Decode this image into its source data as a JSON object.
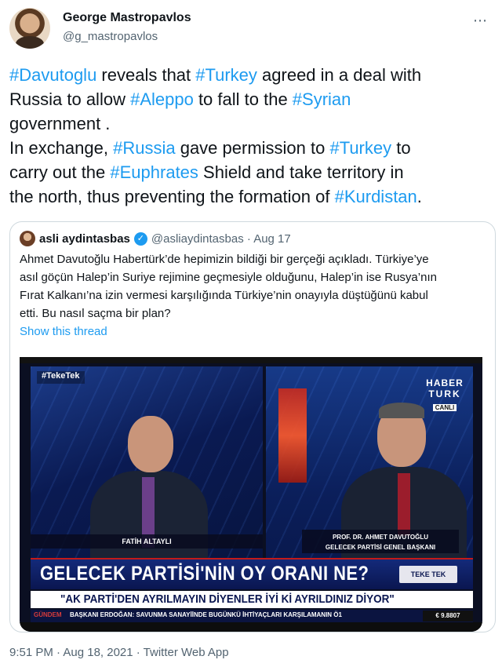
{
  "author": {
    "name": "George Mastropavlos",
    "handle": "@g_mastropavlos",
    "more_icon": "⋯"
  },
  "tweet": {
    "lines": [
      [
        {
          "t": "#Davutoglu",
          "tag": true
        },
        {
          "t": " reveals that "
        },
        {
          "t": "#Turkey",
          "tag": true
        },
        {
          "t": " agreed in a deal with"
        }
      ],
      [
        {
          "t": "Russia to allow "
        },
        {
          "t": "#Aleppo",
          "tag": true
        },
        {
          "t": " to fall to the "
        },
        {
          "t": "#Syrian",
          "tag": true
        }
      ],
      [
        {
          "t": "government ."
        }
      ],
      [
        {
          "t": "In exchange, "
        },
        {
          "t": "#Russia",
          "tag": true
        },
        {
          "t": " gave permission to "
        },
        {
          "t": "#Turkey",
          "tag": true
        },
        {
          "t": " to"
        }
      ],
      [
        {
          "t": "carry out the "
        },
        {
          "t": "#Euphrates",
          "tag": true
        },
        {
          "t": " Shield and take territory in"
        }
      ],
      [
        {
          "t": "the north, thus preventing the formation of "
        },
        {
          "t": "#Kurdistan",
          "tag": true
        },
        {
          "t": "."
        }
      ]
    ]
  },
  "quote": {
    "name": "asli aydintasbas",
    "verified_icon": "✓",
    "handle_date": "@asliaydintasbas · Aug 17",
    "lines": [
      "Ahmet Davutoğlu Habertürk’de hepimizin bildiği bir gerçeği açıkladı. Türkiye’ye",
      "asıl göçün Halep’in Suriye rejimine geçmesiyle olduğunu, Halep’in ise Rusya’nın",
      "Fırat Kalkanı’na izin vermesi karşılığında Türkiye’nin onayıyla düştüğünü kabul",
      "etti. Bu nasıl saçma bir plan?"
    ],
    "show_thread": "Show this thread"
  },
  "media": {
    "corner_tag": "#TekeTek",
    "logo_line1": "HABER",
    "logo_line2": "TURK",
    "logo_line3": "CANLI",
    "left_name": "FATİH ALTAYLI",
    "right_name": "PROF. DR. AHMET DAVUTOĞLU",
    "right_title": "GELECEK PARTİSİ GENEL BAŞKANI",
    "headline": "GELECEK PARTİSİ'NİN OY ORANI NE?",
    "badge": "TEKE TEK",
    "subline": "\"AK PARTİ'DEN AYRILMAYIN DİYENLER İYİ Kİ AYRILDINIZ DİYOR\"",
    "ticker_label": "GÜNDEM",
    "ticker_text": "BAŞKANI ERDOĞAN: SAVUNMA SANAYİİNDE BUGÜNKÜ İHTİYAÇLARI KARŞILAMANIN Ö1",
    "rate": "€ 9.8807",
    "colors": {
      "accent": "#1d9bf0",
      "tv_blue": "#0a1650",
      "tv_red": "#c41a1a"
    }
  },
  "footer": {
    "meta": "9:51 PM · Aug 18, 2021 · Twitter Web App"
  }
}
